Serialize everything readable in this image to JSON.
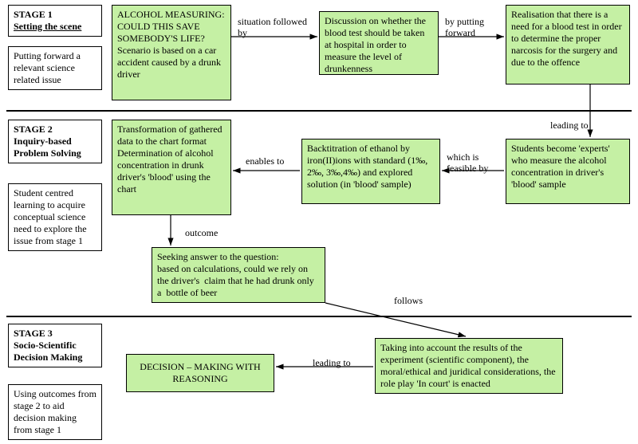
{
  "stage1": {
    "title": "STAGE 1",
    "subtitle": "Setting the scene",
    "desc": "Putting forward a relevant science related issue",
    "box1": "ALCOHOL MEASURING: COULD THIS SAVE SOMEBODY'S LIFE?\nScenario is based on a car  accident caused by a drunk driver",
    "arrow1": "situation followed  by",
    "box2": "Discussion on whether the blood test should be taken at hospital in order to measure  the level of drunkenness",
    "arrow2": "by putting\nforward",
    "box3": "Realisation that there is a need for a blood test in order to determine the proper narcosis for the surgery and due to the offence"
  },
  "stage2": {
    "title": "STAGE 2",
    "subtitle": "Inquiry-based Problem Solving",
    "desc": "Student centred learning to acquire conceptual science need to explore the issue from stage 1",
    "arrow_in": "leading to",
    "box_students": "Students become 'experts' who measure the alcohol concentration in driver's 'blood' sample",
    "arrow_feasible": "which is feasible by",
    "box_backtitration": "Backtitration of ethanol by iron(II)ions with standard (1‰, 2‰, 3‰,4‰) and explored solution (in 'blood'  sample)",
    "arrow_enables": "enables to",
    "box_transform": "Transformation of gathered data to the chart format\nDetermination of alcohol concentration in drunk driver's 'blood' using the chart",
    "arrow_outcome": "outcome",
    "box_seeking": "Seeking answer to the question:\nbased on calculations, could we rely on the driver's  claim that he had drunk only a  bottle of beer",
    "arrow_follows": "follows"
  },
  "stage3": {
    "title": "STAGE 3",
    "subtitle": "Socio-Scientific Decision Making",
    "desc": "Using outcomes from stage 2 to aid decision making from stage 1",
    "box_taking": "Taking into account the results of the experiment (scientific component), the moral/ethical and juridical considerations, the role play 'In court' is enacted",
    "arrow_leading": "leading to",
    "box_decision": "DECISION – MAKING WITH REASONING"
  }
}
